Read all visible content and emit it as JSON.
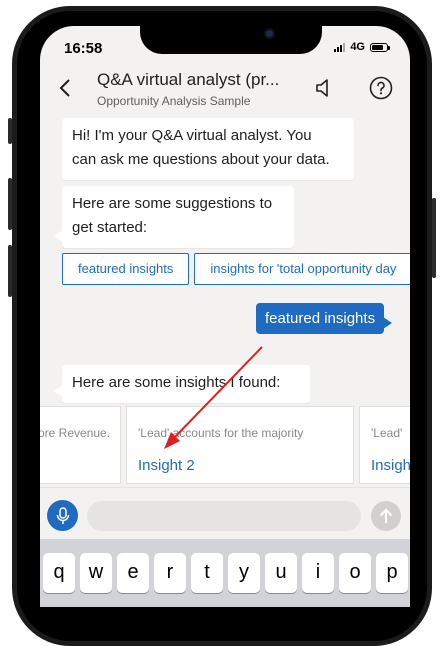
{
  "status_bar": {
    "time": "16:58",
    "network": "4G",
    "battery_level": 0.75
  },
  "header": {
    "title": "Q&A virtual analyst (pr...",
    "subtitle": "Opportunity Analysis Sample",
    "back_icon": "chevron-left-icon",
    "speaker_icon": "speaker-icon",
    "help_icon": "help-circle-icon"
  },
  "messages": {
    "greeting_line1": "Hi! I'm your Q&A virtual analyst. You",
    "greeting_line2": "can ask me questions about your data.",
    "suggestions_line1": "Here are some suggestions to",
    "suggestions_line2": "get started:",
    "user_message": "featured insights",
    "insights_found": "Here are some insights I found:"
  },
  "suggestions": [
    "featured insights",
    "insights for 'total opportunity day"
  ],
  "insight_cards": [
    {
      "desc": "ore Revenue.",
      "title": ""
    },
    {
      "desc": "'Lead' accounts for the majority",
      "title": "Insight 2"
    },
    {
      "desc": "'Lead'",
      "title": "Insigh"
    }
  ],
  "input": {
    "value": "",
    "mic_icon": "microphone-icon",
    "send_icon": "send-arrow-up-icon"
  },
  "keyboard": {
    "row1": [
      "q",
      "w",
      "e",
      "r",
      "t",
      "y",
      "u",
      "i",
      "o",
      "p"
    ]
  },
  "colors": {
    "accent": "#1f6bc1",
    "annotation_arrow": "#e02020",
    "background": "#f3f2f1"
  }
}
